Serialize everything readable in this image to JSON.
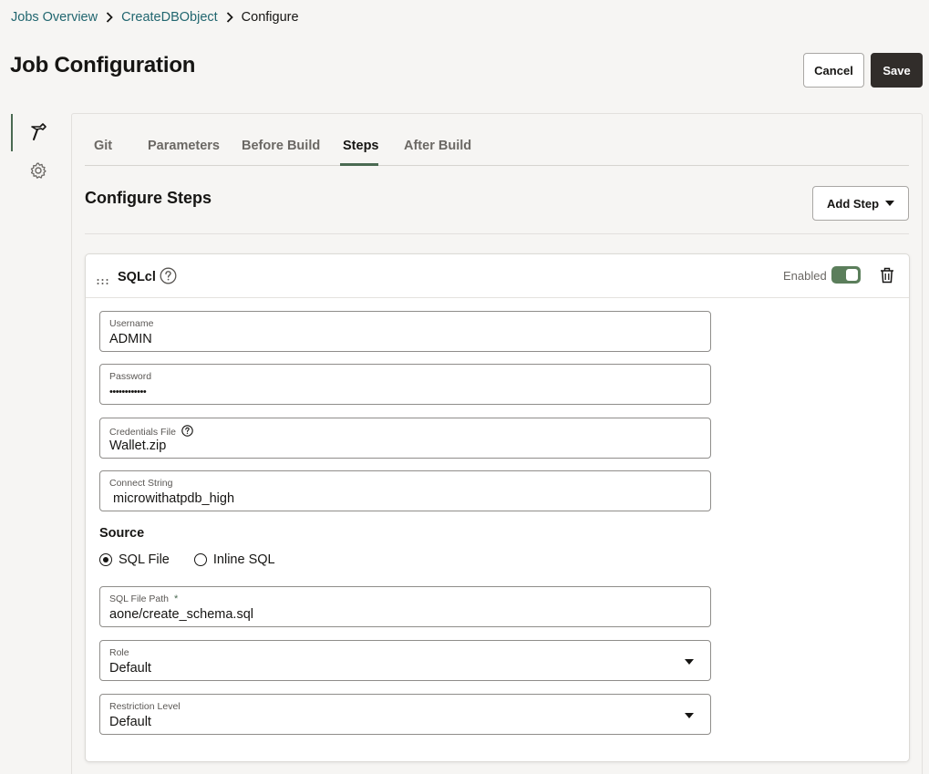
{
  "breadcrumb": {
    "items": [
      "Jobs Overview",
      "CreateDBObject"
    ],
    "current": "Configure"
  },
  "page": {
    "title": "Job Configuration",
    "cancel_label": "Cancel",
    "save_label": "Save"
  },
  "rail": {
    "items": [
      {
        "icon": "hammer-icon",
        "active": true
      },
      {
        "icon": "gear-icon",
        "active": false
      }
    ]
  },
  "tabs": [
    {
      "label": "Git"
    },
    {
      "label": "Parameters"
    },
    {
      "label": "Before Build"
    },
    {
      "label": "Steps",
      "active": true
    },
    {
      "label": "After Build"
    }
  ],
  "section": {
    "title": "Configure Steps",
    "add_step_label": "Add Step"
  },
  "step": {
    "title": "SQLcl",
    "enabled_label": "Enabled",
    "enabled": true,
    "fields": {
      "username": {
        "label": "Username",
        "value": "ADMIN"
      },
      "password": {
        "label": "Password",
        "value": "••••••••••••"
      },
      "credentials_file": {
        "label": "Credentials File",
        "value": "Wallet.zip"
      },
      "connect_string": {
        "label": "Connect String",
        "value": " microwithatpdb_high"
      },
      "sql_file_path": {
        "label": "SQL File Path",
        "required_mark": "*",
        "value": "aone/create_schema.sql"
      },
      "role": {
        "label": "Role",
        "value": "Default"
      },
      "restriction_level": {
        "label": "Restriction Level",
        "value": "Default"
      }
    },
    "source": {
      "label": "Source",
      "options": [
        {
          "label": "SQL File",
          "checked": true
        },
        {
          "label": "Inline SQL",
          "checked": false
        }
      ]
    }
  },
  "colors": {
    "accent": "#4a6a52",
    "link": "#21666f",
    "save_bg": "#312d2a",
    "toggle_on": "#5b7e5b"
  }
}
